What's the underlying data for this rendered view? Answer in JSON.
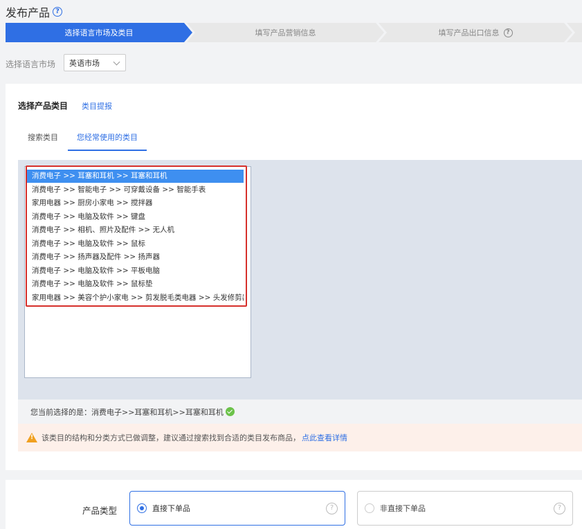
{
  "header": {
    "title": "发布产品"
  },
  "steps": [
    {
      "label": "选择语言市场及类目"
    },
    {
      "label": "填写产品营销信息"
    },
    {
      "label": "填写产品出口信息"
    }
  ],
  "market": {
    "label": "选择语言市场",
    "selected": "英语市场"
  },
  "category": {
    "title": "选择产品类目",
    "link": "类目提报",
    "tabs": [
      {
        "label": "搜索类目"
      },
      {
        "label": "您经常使用的类目"
      }
    ],
    "items": [
      "消费电子 >> 耳塞和耳机 >> 耳塞和耳机",
      "消费电子 >> 智能电子 >> 可穿戴设备 >> 智能手表",
      "家用电器 >> 厨房小家电 >> 搅拌器",
      "消费电子 >> 电脑及软件 >> 键盘",
      "消费电子 >> 相机、照片及配件 >> 无人机",
      "消费电子 >> 电脑及软件 >> 鼠标",
      "消费电子 >> 扬声器及配件 >> 扬声器",
      "消费电子 >> 电脑及软件 >> 平板电脑",
      "消费电子 >> 电脑及软件 >> 鼠标垫",
      "家用电器 >> 美容个护小家电 >> 剪发脱毛类电器 >> 头发修剪器"
    ],
    "current_label": "您当前选择的是：",
    "current_value": "消费电子>>耳塞和耳机>>耳塞和耳机",
    "warning_text": "该类目的结构和分类方式已做调整，建议通过搜索找到合适的类目发布商品，",
    "warning_link": "点此查看详情"
  },
  "product_type": {
    "label": "产品类型",
    "options": [
      {
        "label": "直接下单品"
      },
      {
        "label": "非直接下单品"
      }
    ]
  },
  "icons": {
    "help": "question-circle-icon",
    "check": "check-circle-icon",
    "warning": "warning-triangle-icon"
  },
  "colors": {
    "accent": "#2f6fe4",
    "selected_row": "#3e8ff0",
    "highlight": "#d6302b",
    "success": "#6cc24a",
    "warning": "#f0a020"
  }
}
